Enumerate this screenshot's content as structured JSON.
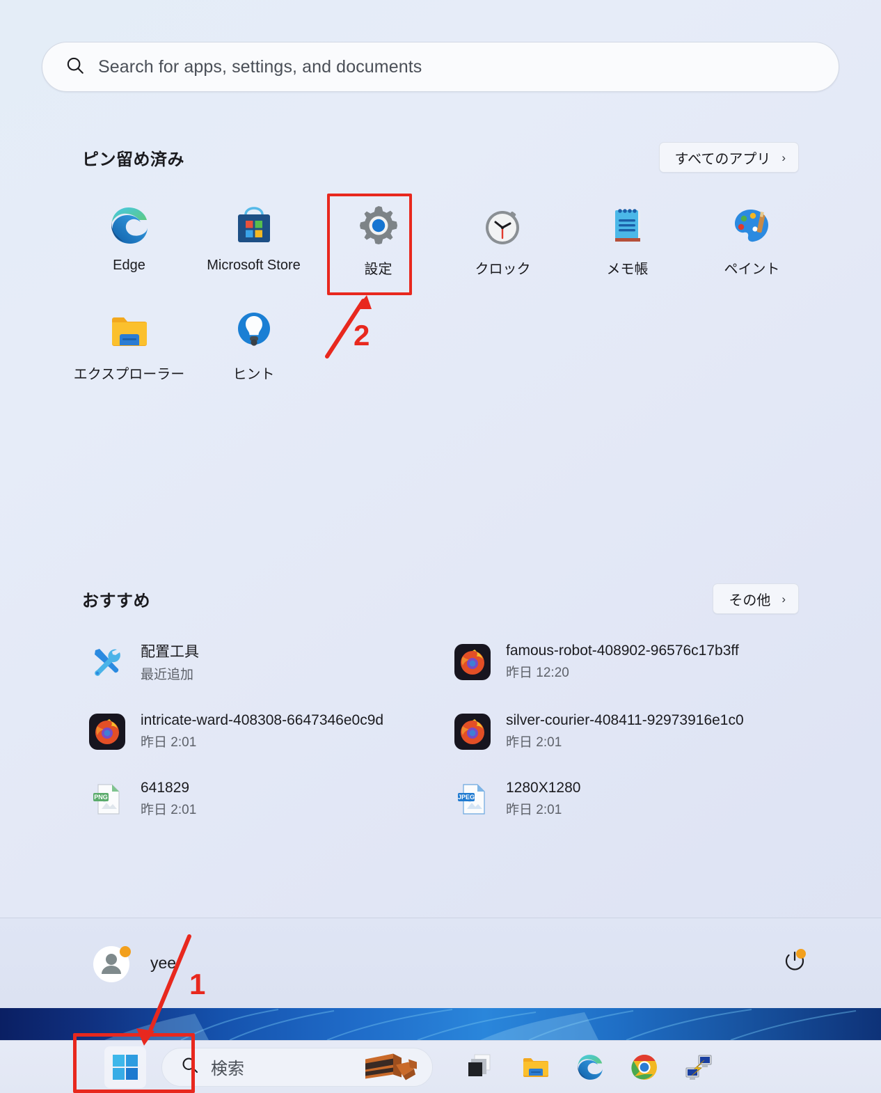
{
  "theme": {
    "accent": "#0078d4",
    "annotation_red": "#e8281e",
    "badge_orange": "#f5a623",
    "panel_bg": "#e4ecf7",
    "taskbar_bg": "#e3e8f5"
  },
  "search": {
    "placeholder": "Search for apps, settings, and documents",
    "icon": "search-icon"
  },
  "pinned": {
    "title": "ピン留め済み",
    "all_apps_label": "すべてのアプリ",
    "all_apps_chevron": "›",
    "apps": [
      {
        "label": "Edge",
        "icon": "edge-icon"
      },
      {
        "label": "Microsoft Store",
        "icon": "microsoft-store-icon"
      },
      {
        "label": "設定",
        "icon": "settings-gear-icon"
      },
      {
        "label": "クロック",
        "icon": "clock-icon"
      },
      {
        "label": "メモ帳",
        "icon": "notepad-icon"
      },
      {
        "label": "ペイント",
        "icon": "paint-palette-icon"
      },
      {
        "label": "エクスプローラー",
        "icon": "file-explorer-icon"
      },
      {
        "label": "ヒント",
        "icon": "tips-lightbulb-icon"
      }
    ]
  },
  "recommended": {
    "title": "おすすめ",
    "more_label": "その他",
    "more_chevron": "›",
    "items": [
      {
        "title": "配置工具",
        "subtitle": "最近追加",
        "icon": "tools-icon"
      },
      {
        "title": "famous-robot-408902-96576c17b3ff",
        "subtitle": "昨日 12:20",
        "icon": "firefox-icon"
      },
      {
        "title": "intricate-ward-408308-6647346e0c9d",
        "subtitle": "昨日 2:01",
        "icon": "firefox-icon"
      },
      {
        "title": "silver-courier-408411-92973916e1c0",
        "subtitle": "昨日 2:01",
        "icon": "firefox-icon"
      },
      {
        "title": "641829",
        "subtitle": "昨日 2:01",
        "icon": "png-file-icon",
        "badge": "PNG"
      },
      {
        "title": "1280X1280",
        "subtitle": "昨日 2:01",
        "icon": "jpeg-file-icon",
        "badge": "JPEG"
      }
    ]
  },
  "footer": {
    "user_name": "yee",
    "avatar_icon": "user-avatar-icon",
    "power_icon": "power-icon"
  },
  "taskbar": {
    "start_icon": "windows-start-icon",
    "search_placeholder": "検索",
    "search_icon": "search-icon",
    "search_illustration": "cake-icon",
    "items": [
      {
        "icon": "task-view-icon",
        "name": "task-view"
      },
      {
        "icon": "file-explorer-icon",
        "name": "file-explorer"
      },
      {
        "icon": "edge-icon",
        "name": "edge"
      },
      {
        "icon": "chrome-icon",
        "name": "chrome"
      },
      {
        "icon": "remote-desktop-icon",
        "name": "remote-desktop"
      }
    ]
  },
  "annotations": {
    "step1": "1",
    "step2": "2"
  }
}
